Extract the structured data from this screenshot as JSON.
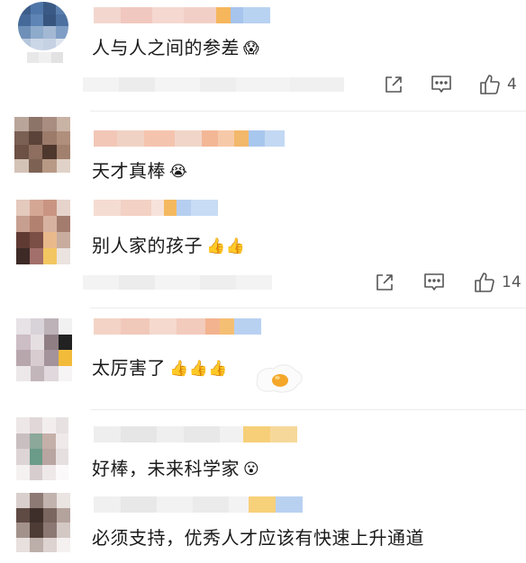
{
  "comments": [
    {
      "text": "人与人之间的参差",
      "emoji": "😱"
    },
    {
      "text": "天才真棒",
      "emoji": "😭"
    },
    {
      "text": "别人家的孩子",
      "emoji": "👍👍"
    },
    {
      "text": "太厉害了",
      "emoji": "👍👍👍"
    },
    {
      "text": "好棒，未来科学家",
      "emoji": "😮"
    },
    {
      "text": "必须支持，优秀人才应该有快速上升通道",
      "emoji": ""
    }
  ],
  "actions": {
    "first": {
      "like_count": "4"
    },
    "second": {
      "like_count": "14"
    }
  },
  "icons": [
    "share-icon",
    "comment-icon",
    "thumbs-up-icon",
    "fried-egg-icon"
  ],
  "colors": {
    "icon_gray": "#555555",
    "divider": "#ececec",
    "text": "#1a1a1a"
  }
}
